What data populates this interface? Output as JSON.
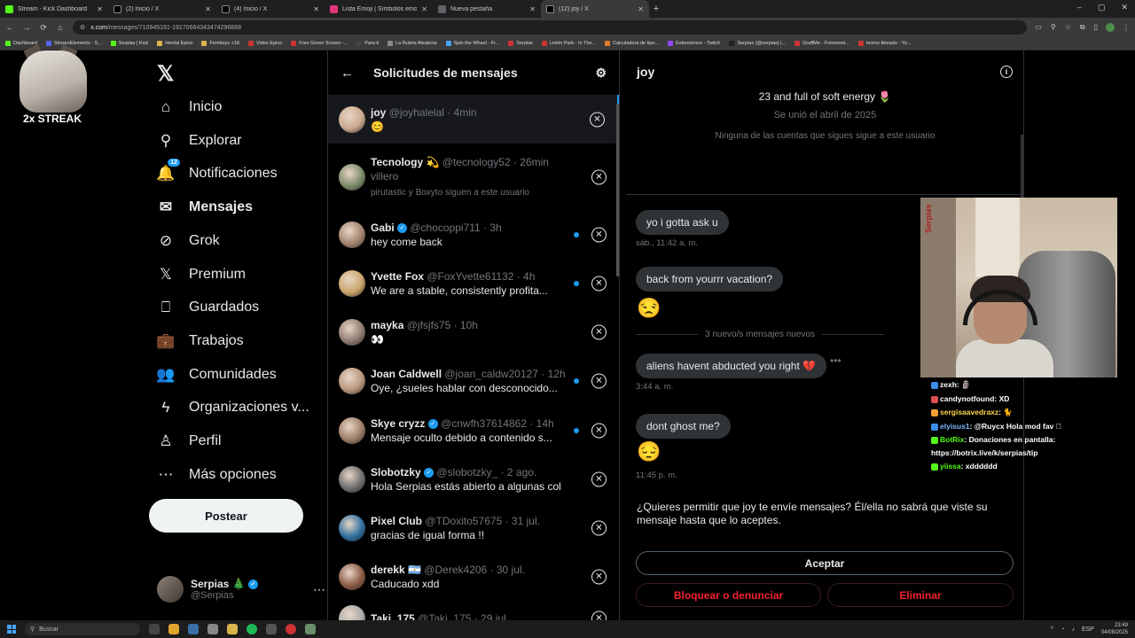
{
  "browser": {
    "tabs": [
      {
        "label": "Stream - Kick Dashboard",
        "color": "#53fc18",
        "active": false
      },
      {
        "label": "(2) Inicio / X",
        "color": "#000000",
        "active": false
      },
      {
        "label": "(4) Inicio / X",
        "color": "#000000",
        "active": false
      },
      {
        "label": "Lista Emoji | Símbolos emoji ni",
        "color": "#e3357c",
        "active": false
      },
      {
        "label": "Nueva pestaña",
        "color": "#5f6368",
        "active": false
      },
      {
        "label": "(12) joy / X",
        "color": "#000000",
        "active": true
      }
    ],
    "url_host": "x.com",
    "url_path": "/messages/710945191-19170664343474296868",
    "bookmarks": [
      "Dashboard",
      "StreamElements - S...",
      "Serpias | Kick",
      "Hentai Epico",
      "Femboys +18",
      "Video Epico",
      "Free Green Screen -...",
      "Para ti",
      "La Ruleta Aleatoria",
      "Spin the Wheel - Fr...",
      "Serpias",
      "Linkin Park - In The...",
      "Calculadora de tipo...",
      "Extensiones - Twitch",
      "Serpias (@serpias) |...",
      "GraffMe - Fotomont...",
      "momo titreado - Yo..."
    ]
  },
  "streak": {
    "label": "2x STREAK"
  },
  "nav": {
    "items": [
      {
        "label": "Inicio",
        "icon": "home-icon",
        "glyph": "⌂"
      },
      {
        "label": "Explorar",
        "icon": "search-icon",
        "glyph": "⚲"
      },
      {
        "label": "Notificaciones",
        "icon": "bell-icon",
        "glyph": "🔔",
        "badge": "12"
      },
      {
        "label": "Mensajes",
        "icon": "mail-icon",
        "glyph": "✉",
        "bold": true
      },
      {
        "label": "Grok",
        "icon": "grok-icon",
        "glyph": "⊘"
      },
      {
        "label": "Premium",
        "icon": "x-premium-icon",
        "glyph": "𝕏"
      },
      {
        "label": "Guardados",
        "icon": "bookmark-icon",
        "glyph": "⎕"
      },
      {
        "label": "Trabajos",
        "icon": "briefcase-icon",
        "glyph": "💼"
      },
      {
        "label": "Comunidades",
        "icon": "people-icon",
        "glyph": "👥"
      },
      {
        "label": "Organizaciones v...",
        "icon": "lightning-icon",
        "glyph": "ϟ"
      },
      {
        "label": "Perfil",
        "icon": "person-icon",
        "glyph": "♙"
      },
      {
        "label": "Más opciones",
        "icon": "more-circle-icon",
        "glyph": "⋯"
      }
    ],
    "post_label": "Postear",
    "account": {
      "name": "Serpias 🎄",
      "handle": "@Serpias"
    }
  },
  "requests": {
    "title": "Solicitudes de mensajes",
    "items": [
      {
        "name": "joy",
        "meta": "@joyhalelal · 4min",
        "text": "😊",
        "verified": false,
        "unread": false,
        "selected": true,
        "avatar": "#c9a98f"
      },
      {
        "name": "Tecnology 💫",
        "meta": "@tecnology52 · 26min",
        "text": "villero",
        "sub": "pirutastic y Boxyto siguen a este usuario",
        "verified": false,
        "unread": false,
        "avatar": "#7c8b6a"
      },
      {
        "name": "Gabi",
        "meta": "@chocoppi711 · 3h",
        "text": "hey come back",
        "verified": true,
        "unread": true,
        "avatar": "#a3846e"
      },
      {
        "name": "Yvette Fox",
        "meta": "@FoxYvette61132 · 4h",
        "text": "We are a stable, consistently profita...",
        "verified": false,
        "unread": true,
        "avatar": "#caa56b"
      },
      {
        "name": "mayka",
        "meta": "@jfsjfs75 · 10h",
        "text": "👀",
        "verified": false,
        "unread": false,
        "avatar": "#8e7b72"
      },
      {
        "name": "Joan Caldwell",
        "meta": "@joan_caldw20127 · 12h",
        "text": "Oye, ¿sueles hablar con desconocido...",
        "verified": false,
        "unread": true,
        "avatar": "#b8977d"
      },
      {
        "name": "Skye cryzz",
        "meta": "@cnwfh37614862 · 14h",
        "text": "Mensaje oculto debido a contenido s...",
        "verified": true,
        "unread": true,
        "avatar": "#9c7d68"
      },
      {
        "name": "Slobotzky",
        "meta": "@slobotzky_ · 2 ago.",
        "text": "Hola Serpias estás abierto a algunas col...",
        "verified": true,
        "unread": false,
        "avatar": "#6e6e6e"
      },
      {
        "name": "Pixel Club",
        "meta": "@TDoxito57675 · 31 jul.",
        "text": "gracias de igual forma !!",
        "verified": false,
        "unread": false,
        "avatar": "#2e6f9e"
      },
      {
        "name": "derekk 🇦🇷",
        "meta": "@Derek4206 · 30 jul.",
        "text": "Caducado xdd",
        "verified": false,
        "unread": false,
        "avatar": "#8a5a44"
      },
      {
        "name": "Taki_175",
        "meta": "@Taki_175 · 29 jul.",
        "text": "",
        "verified": false,
        "unread": false,
        "avatar": "#aaaaaa"
      }
    ]
  },
  "conversation": {
    "title": "joy",
    "bio": "23 and full of soft energy 🌷",
    "joined": "Se unió el abril de 2025",
    "followers_note": "Ninguna de las cuentas que sigues sigue a este usuario",
    "messages": [
      {
        "text": "yo i gotta ask u",
        "time": "sáb., 11:42 a. m."
      },
      {
        "text": "back from yourrr vacation?",
        "emoji": "😒"
      },
      {
        "separator": "3 nuevo/s mensajes nuevos"
      },
      {
        "text": "aliens havent abducted you right 💔",
        "time": "3:44 a. m."
      },
      {
        "text": "dont ghost me?",
        "emoji": "😔",
        "time": "11:45 p. m."
      }
    ],
    "permit_text": "¿Quieres permitir que joy te envíe mensajes? Él/ella no sabrá que viste su mensaje hasta que lo aceptes.",
    "accept_label": "Aceptar",
    "block_label": "Bloquear o denunciar",
    "delete_label": "Eliminar"
  },
  "stream": {
    "webcam_sign": "Serpias",
    "chat": [
      {
        "user": "zexh",
        "msg": ": 🗿",
        "color": "#ffffff"
      },
      {
        "user": "candynotfound",
        "msg": ": XD",
        "color": "#ffffff"
      },
      {
        "user": "sergisaavedraxz",
        "msg": ": 🐈",
        "color": "#ffd54a"
      },
      {
        "user": "elyisus1",
        "msg": ": @Ruycx Hola mod fav 🏾",
        "color": "#7fb8ff"
      },
      {
        "user": "BotRix",
        "msg": ": Donaciones en pantalla:",
        "color": "#53fc18"
      },
      {
        "user": "",
        "msg": "https://botrix.live/k/serpias/tip",
        "color": "#ffffff"
      },
      {
        "user": "yiissa",
        "msg": ": xdddddd",
        "color": "#53fc18"
      }
    ]
  },
  "taskbar": {
    "search_label": "Buscar",
    "lang": "ESP",
    "time": "23:49",
    "date": "04/08/2025"
  }
}
